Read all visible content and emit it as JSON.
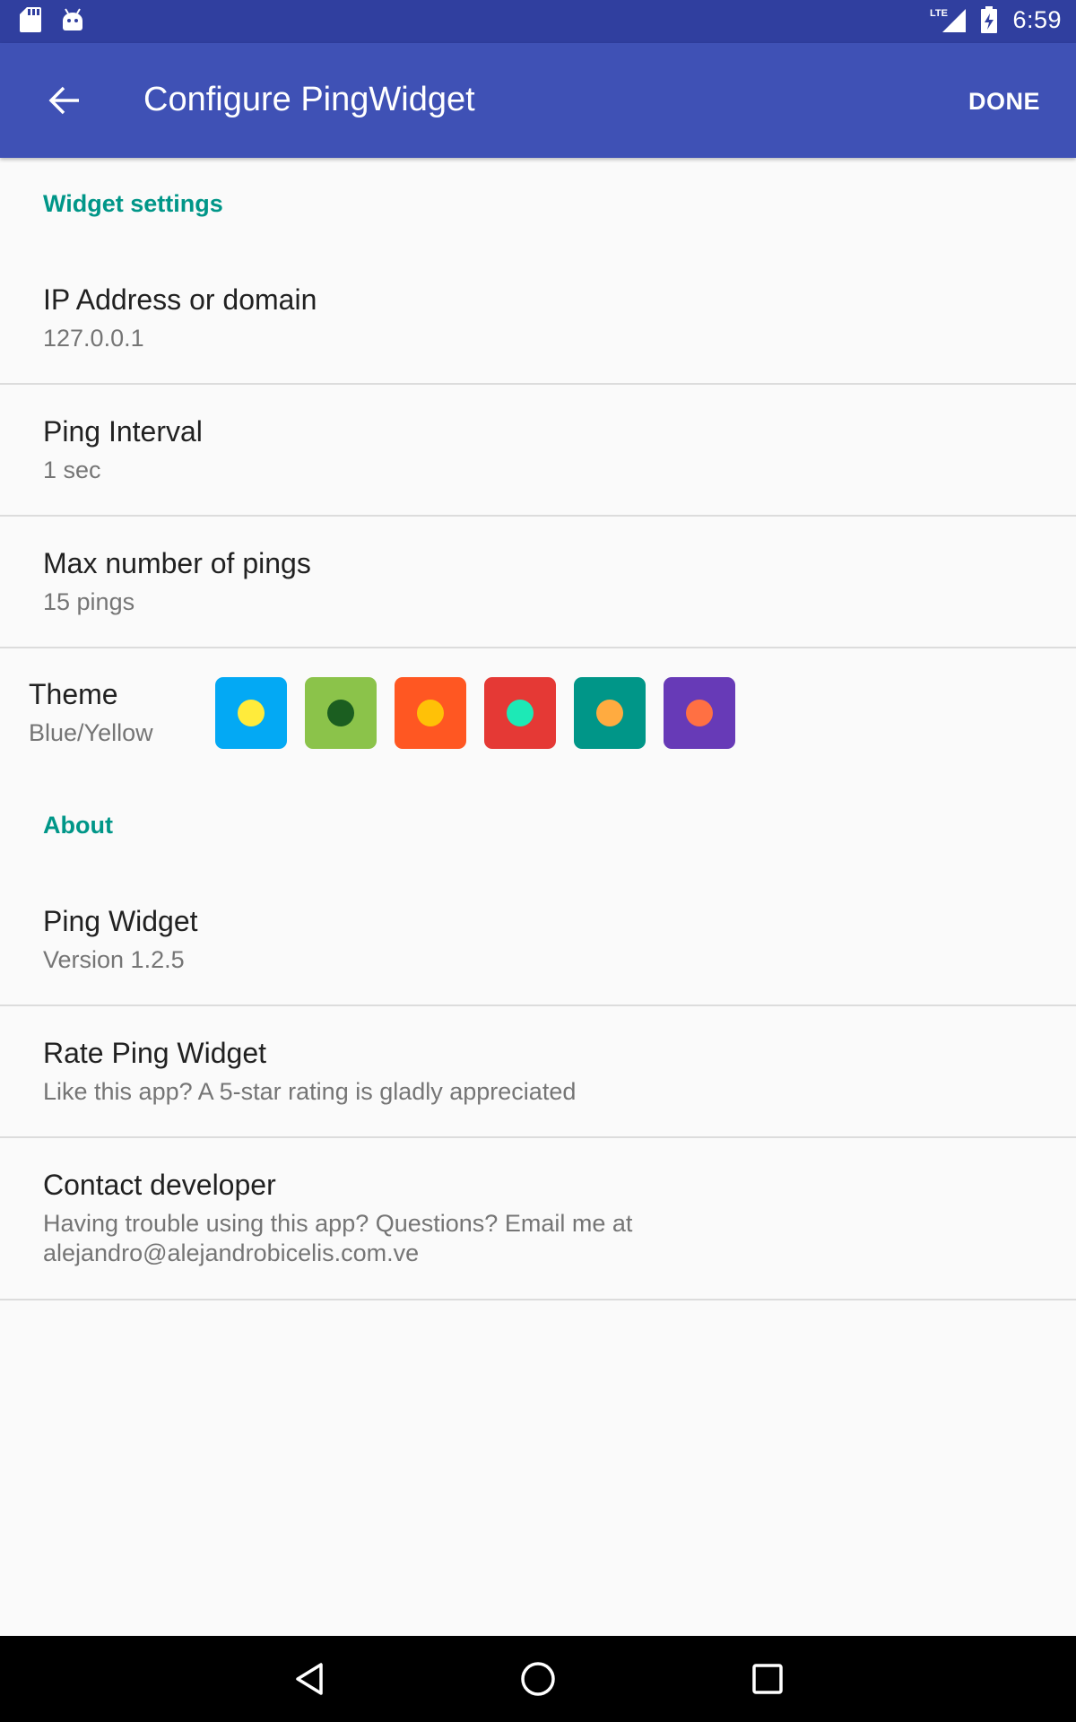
{
  "status_bar": {
    "time": "6:59",
    "network": "LTE",
    "icons": [
      "sd-card-icon",
      "android-icon",
      "signal-icon",
      "battery-charging-icon"
    ]
  },
  "app_bar": {
    "title": "Configure PingWidget",
    "done_label": "DONE",
    "back_icon": "arrow-back-icon",
    "color": "#3f51b5"
  },
  "widget_settings": {
    "header": "Widget settings",
    "ip": {
      "title": "IP Address or domain",
      "summary": "127.0.0.1"
    },
    "interval": {
      "title": "Ping Interval",
      "summary": "1 sec"
    },
    "max_pings": {
      "title": "Max number of pings",
      "summary": "15 pings"
    },
    "theme": {
      "title": "Theme",
      "summary": "Blue/Yellow",
      "swatches": [
        {
          "bg": "#03a9f4",
          "dot": "#ffeb3b"
        },
        {
          "bg": "#8bc34a",
          "dot": "#1b5e20"
        },
        {
          "bg": "#ff5722",
          "dot": "#ffc107"
        },
        {
          "bg": "#e53935",
          "dot": "#1de9b6"
        },
        {
          "bg": "#009688",
          "dot": "#ffab40"
        },
        {
          "bg": "#673ab7",
          "dot": "#ff7043"
        }
      ]
    }
  },
  "about": {
    "header": "About",
    "app": {
      "title": "Ping Widget",
      "summary": "Version 1.2.5"
    },
    "rate": {
      "title": "Rate Ping Widget",
      "summary": "Like this app? A 5-star rating is gladly appreciated"
    },
    "contact": {
      "title": "Contact developer",
      "summary": "Having trouble using this app? Questions? Email me at alejandro@alejandrobicelis.com.ve"
    }
  },
  "accent_color": "#009688",
  "nav_bar": {
    "icons": [
      "back-triangle-icon",
      "home-circle-icon",
      "recents-square-icon"
    ]
  }
}
